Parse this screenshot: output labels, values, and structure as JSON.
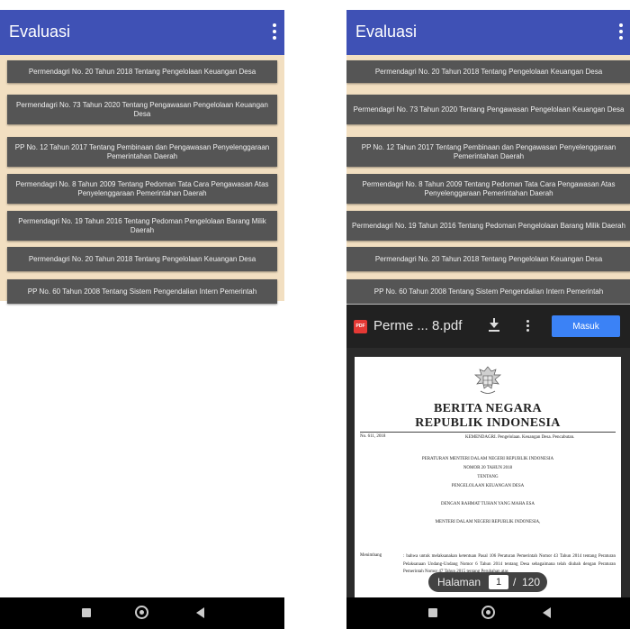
{
  "app": {
    "title": "Evaluasi"
  },
  "list_items": [
    "Permendagri No. 20 Tahun 2018 Tentang Pengelolaan Keuangan Desa",
    "Permendagri No. 73 Tahun 2020 Tentang Pengawasan Pengelolaan Keuangan Desa",
    "PP No. 12 Tahun 2017 Tentang Pembinaan dan Pengawasan Penyelenggaraan Pemerintahan Daerah",
    "Permendagri No. 8 Tahun 2009 Tentang Pedoman Tata Cara Pengawasan Atas Penyelenggaraan Pemerintahan Daerah",
    "Permendagri No. 19 Tahun 2016 Tentang Pedoman Pengelolaan Barang Milik Daerah",
    "Permendagri No. 20 Tahun 2018 Tentang Pengelolaan Keuangan Desa",
    "PP No. 60 Tahun 2008 Tentang Sistem Pengendalian Intern Pemerintah"
  ],
  "pdf_viewer": {
    "file_badge": "PDF",
    "file_name": "Perme ... 8.pdf",
    "sign_in_label": "Masuk",
    "page_label": "Halaman",
    "current_page": "1",
    "page_separator": "/",
    "total_pages": "120"
  },
  "document": {
    "heading_line1": "BERITA NEGARA",
    "heading_line2": "REPUBLIK INDONESIA",
    "number": "No. 611, 2018",
    "ministry": "KEMENDAGRI. Pengelolaan. Keuangan Desa. Pencabutan.",
    "regulation": "PERATURAN MENTERI DALAM NEGERI REPUBLIK INDONESIA",
    "regulation_number": "NOMOR 20 TAHUN 2018",
    "about": "TENTANG",
    "subject": "PENGELOLAAN KEUANGAN DESA",
    "blessing": "DENGAN RAHMAT TUHAN YANG MAHA ESA",
    "minister": "MENTERI DALAM NEGERI REPUBLIK INDONESIA,",
    "consider_label": "Menimbang",
    "consider_text": ": bahwa untuk melaksanakan ketentuan Pasal 106 Peraturan Pemerintah Nomor 43 Tahun 2014 tentang Peraturan Pelaksanaan Undang-Undang Nomor 6 Tahun 2014 tentang Desa sebagaimana telah diubah dengan Peraturan Pemerintah Nomor 47 Tahun 2015 tentang Perubahan atas"
  }
}
